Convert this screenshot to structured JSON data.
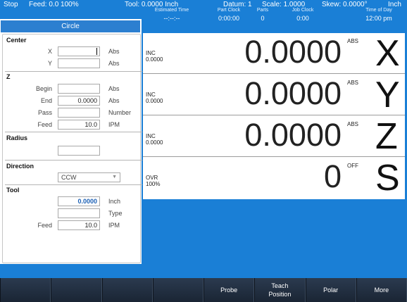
{
  "status": {
    "mode": "Stop",
    "feed": "Feed:  0.0 100%",
    "tool": "Tool: 0.0000 Inch",
    "datum": "Datum: 1",
    "scale": "Scale: 1.0000",
    "skew": "Skew: 0.0000°",
    "units": "Inch",
    "estimated_time": {
      "label": "Estimated Time",
      "value": "--:--:--"
    },
    "part_clock": {
      "label": "Part Clock",
      "value": "0:00:00"
    },
    "parts": {
      "label": "Parts",
      "value": "0"
    },
    "job_clock": {
      "label": "Job Clock",
      "value": "0:00"
    },
    "time_of_day": {
      "label": "Time of Day",
      "value": "12:00 pm"
    }
  },
  "panel": {
    "title": "Circle",
    "center": {
      "title": "Center",
      "x": {
        "label": "X",
        "value": "",
        "unit": "Abs"
      },
      "y": {
        "label": "Y",
        "value": "",
        "unit": "Abs"
      }
    },
    "z": {
      "title": "Z",
      "begin": {
        "label": "Begin",
        "value": "",
        "unit": "Abs"
      },
      "end": {
        "label": "End",
        "value": "0.0000",
        "unit": "Abs"
      },
      "pass": {
        "label": "Pass",
        "value": "",
        "unit": "Number"
      },
      "feed": {
        "label": "Feed",
        "value": "10.0",
        "unit": "IPM"
      }
    },
    "radius": {
      "title": "Radius",
      "value": ""
    },
    "direction": {
      "title": "Direction",
      "value": "CCW"
    },
    "tool": {
      "title": "Tool",
      "diameter": {
        "value": "0.0000",
        "unit": "Inch"
      },
      "type": {
        "value": "",
        "unit": "Type"
      },
      "feed": {
        "label": "Feed",
        "value": "10.0",
        "unit": "IPM"
      }
    }
  },
  "dro": [
    {
      "inc": "INC",
      "inc_value": "0.0000",
      "value": "0.0000",
      "mode": "ABS",
      "axis": "X"
    },
    {
      "inc": "INC",
      "inc_value": "0.0000",
      "value": "0.0000",
      "mode": "ABS",
      "axis": "Y"
    },
    {
      "inc": "INC",
      "inc_value": "0.0000",
      "value": "0.0000",
      "mode": "ABS",
      "axis": "Z"
    },
    {
      "inc": "OVR",
      "inc_value": "100%",
      "value": "0",
      "mode": "OFF",
      "axis": "S"
    }
  ],
  "softkeys": {
    "k1": "",
    "k2": "",
    "k3": "",
    "k4": "",
    "probe": "Probe",
    "teach_line1": "Teach",
    "teach_line2": "Position",
    "polar": "Polar",
    "more": "More"
  }
}
